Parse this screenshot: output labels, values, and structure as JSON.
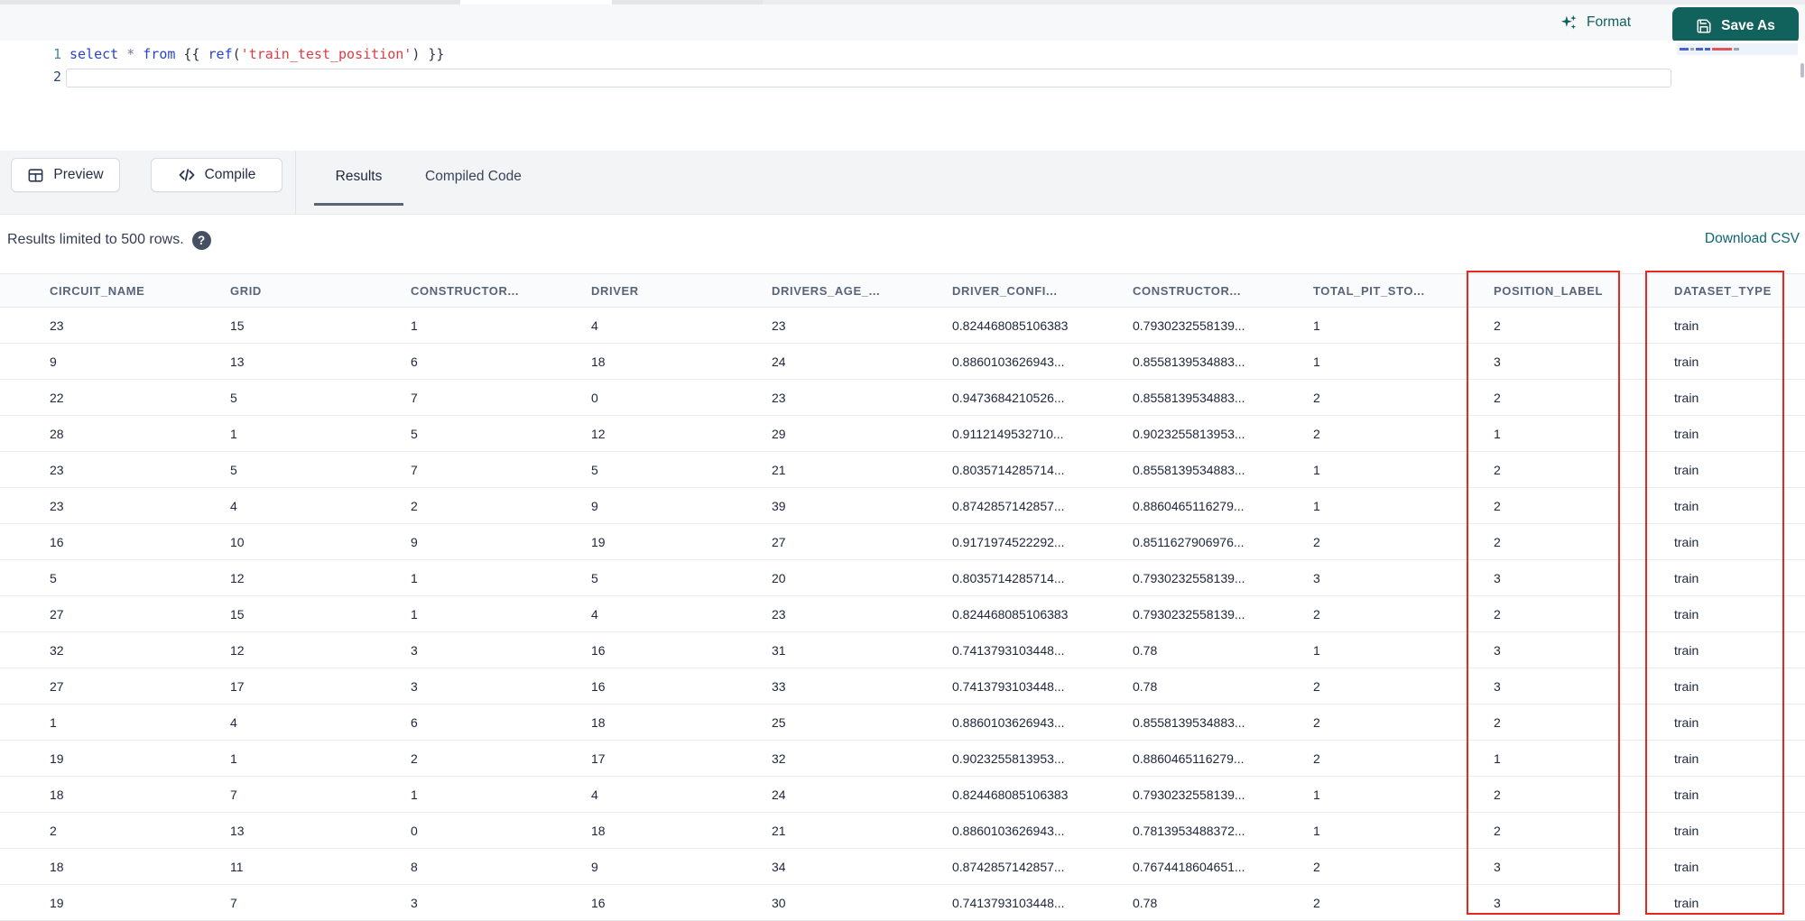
{
  "editor": {
    "toolbar": {
      "format_label": "Format",
      "save_as_label": "Save As"
    },
    "line_numbers": [
      "1",
      "2"
    ],
    "code_tokens": [
      {
        "type": "keyword",
        "text": "select"
      },
      {
        "type": "plain",
        "text": " "
      },
      {
        "type": "operator",
        "text": "*"
      },
      {
        "type": "plain",
        "text": " "
      },
      {
        "type": "keyword",
        "text": "from"
      },
      {
        "type": "plain",
        "text": " {{ "
      },
      {
        "type": "function",
        "text": "ref"
      },
      {
        "type": "plain",
        "text": "("
      },
      {
        "type": "string",
        "text": "'train_test_position'"
      },
      {
        "type": "plain",
        "text": ")"
      },
      {
        "type": "plain",
        "text": " }}"
      }
    ]
  },
  "pane": {
    "preview_label": "Preview",
    "compile_label": "Compile",
    "tabs": [
      {
        "label": "Results",
        "active": true
      },
      {
        "label": "Compiled Code",
        "active": false
      }
    ]
  },
  "results": {
    "limit_note": "Results limited to 500 rows.",
    "help_glyph": "?",
    "download_csv_label": "Download CSV"
  },
  "table": {
    "columns": [
      "CIRCUIT_NAME",
      "GRID",
      "CONSTRUCTOR...",
      "DRIVER",
      "DRIVERS_AGE_...",
      "DRIVER_CONFI...",
      "CONSTRUCTOR...",
      "TOTAL_PIT_STO...",
      "POSITION_LABEL",
      "DATASET_TYPE"
    ],
    "rows": [
      [
        "23",
        "15",
        "1",
        "4",
        "23",
        "0.824468085106383",
        "0.7930232558139...",
        "1",
        "2",
        "train"
      ],
      [
        "9",
        "13",
        "6",
        "18",
        "24",
        "0.8860103626943...",
        "0.8558139534883...",
        "1",
        "3",
        "train"
      ],
      [
        "22",
        "5",
        "7",
        "0",
        "23",
        "0.9473684210526...",
        "0.8558139534883...",
        "2",
        "2",
        "train"
      ],
      [
        "28",
        "1",
        "5",
        "12",
        "29",
        "0.9112149532710...",
        "0.9023255813953...",
        "2",
        "1",
        "train"
      ],
      [
        "23",
        "5",
        "7",
        "5",
        "21",
        "0.8035714285714...",
        "0.8558139534883...",
        "1",
        "2",
        "train"
      ],
      [
        "23",
        "4",
        "2",
        "9",
        "39",
        "0.8742857142857...",
        "0.8860465116279...",
        "1",
        "2",
        "train"
      ],
      [
        "16",
        "10",
        "9",
        "19",
        "27",
        "0.9171974522292...",
        "0.8511627906976...",
        "2",
        "2",
        "train"
      ],
      [
        "5",
        "12",
        "1",
        "5",
        "20",
        "0.8035714285714...",
        "0.7930232558139...",
        "3",
        "3",
        "train"
      ],
      [
        "27",
        "15",
        "1",
        "4",
        "23",
        "0.824468085106383",
        "0.7930232558139...",
        "2",
        "2",
        "train"
      ],
      [
        "32",
        "12",
        "3",
        "16",
        "31",
        "0.7413793103448...",
        "0.78",
        "1",
        "3",
        "train"
      ],
      [
        "27",
        "17",
        "3",
        "16",
        "33",
        "0.7413793103448...",
        "0.78",
        "2",
        "3",
        "train"
      ],
      [
        "1",
        "4",
        "6",
        "18",
        "25",
        "0.8860103626943...",
        "0.8558139534883...",
        "2",
        "2",
        "train"
      ],
      [
        "19",
        "1",
        "2",
        "17",
        "32",
        "0.9023255813953...",
        "0.8860465116279...",
        "2",
        "1",
        "train"
      ],
      [
        "18",
        "7",
        "1",
        "4",
        "24",
        "0.824468085106383",
        "0.7930232558139...",
        "1",
        "2",
        "train"
      ],
      [
        "2",
        "13",
        "0",
        "18",
        "21",
        "0.8860103626943...",
        "0.7813953488372...",
        "1",
        "2",
        "train"
      ],
      [
        "18",
        "11",
        "8",
        "9",
        "34",
        "0.8742857142857...",
        "0.7674418604651...",
        "2",
        "3",
        "train"
      ],
      [
        "19",
        "7",
        "3",
        "16",
        "30",
        "0.7413793103448...",
        "0.78",
        "2",
        "3",
        "train"
      ]
    ],
    "highlighted_columns": [
      "POSITION_LABEL",
      "DATASET_TYPE"
    ]
  },
  "colors": {
    "accent_teal": "#11615D",
    "link_teal": "#0D6772",
    "highlight_red": "#E6291E",
    "keyword_blue": "#2A43CF",
    "string_red": "#DC3B43"
  }
}
